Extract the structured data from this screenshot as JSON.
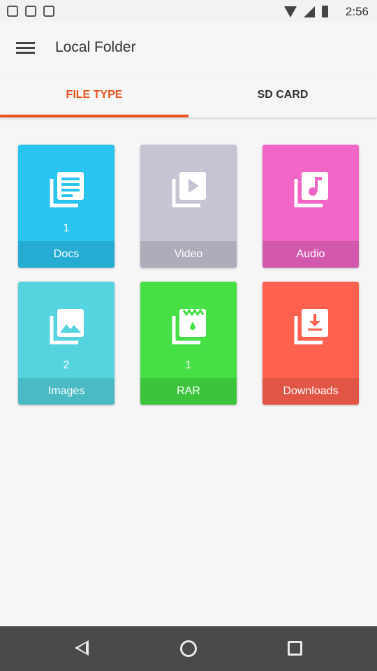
{
  "status_bar": {
    "time": "2:56"
  },
  "app_bar": {
    "title": "Local Folder",
    "menu_icon": "hamburger-menu-icon"
  },
  "tabs": [
    {
      "label": "FILE TYPE",
      "active": true
    },
    {
      "label": "SD CARD",
      "active": false
    }
  ],
  "colors": {
    "accent": "#e8531f",
    "docs": "#29c4f0",
    "video": "#c4c4d4",
    "audio": "#f065c6",
    "images": "#55d4e0",
    "rar": "#46e046",
    "downloads": "#ff6150"
  },
  "tiles": [
    {
      "label": "Docs",
      "count": "1",
      "icon": "document-icon"
    },
    {
      "label": "Video",
      "count": "",
      "icon": "video-play-icon"
    },
    {
      "label": "Audio",
      "count": "",
      "icon": "music-note-icon"
    },
    {
      "label": "Images",
      "count": "2",
      "icon": "image-icon"
    },
    {
      "label": "RAR",
      "count": "1",
      "icon": "archive-icon"
    },
    {
      "label": "Downloads",
      "count": "",
      "icon": "download-icon"
    }
  ],
  "nav_bar": {
    "back": "back-icon",
    "home": "home-icon",
    "recent": "recent-apps-icon"
  }
}
